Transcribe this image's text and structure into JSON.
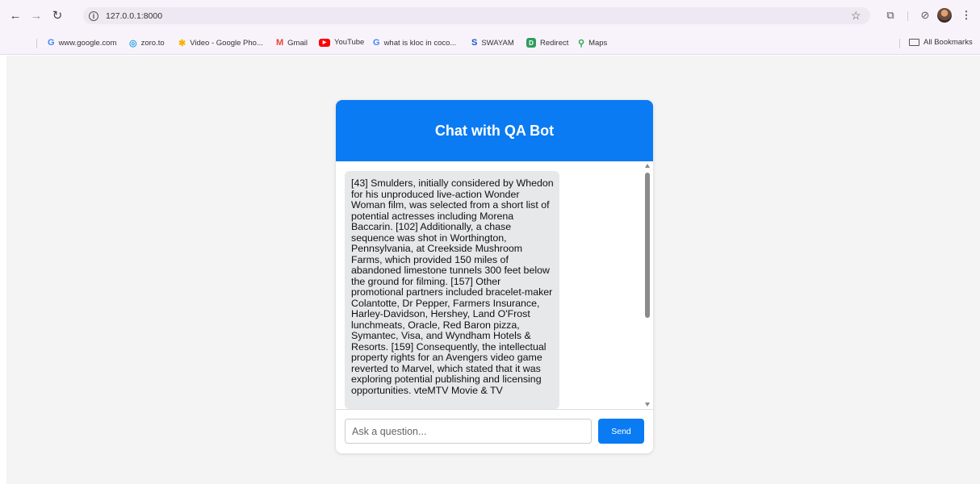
{
  "browser": {
    "url": "127.0.0.1:8000",
    "bookmarks": [
      {
        "label": "www.google.com",
        "icon": "google-icon",
        "color": "#4285f4",
        "glyph": "G"
      },
      {
        "label": "zoro.to",
        "icon": "zoro-icon",
        "color": "#29a3e0",
        "glyph": "◎"
      },
      {
        "label": "Video - Google Pho...",
        "icon": "google-photos-icon",
        "color": "#f4b400",
        "glyph": "✱"
      },
      {
        "label": "Gmail",
        "icon": "gmail-icon",
        "color": "#ea4335",
        "glyph": "M"
      },
      {
        "label": "YouTube",
        "icon": "youtube-icon",
        "color": "#ff0000",
        "glyph": "▶"
      },
      {
        "label": "what is kloc in coco...",
        "icon": "google-icon",
        "color": "#4285f4",
        "glyph": "G"
      },
      {
        "label": "SWAYAM",
        "icon": "swayam-icon",
        "color": "#1a56c6",
        "glyph": "S"
      },
      {
        "label": "Redirect",
        "icon": "redirect-icon",
        "color": "#2e9d5c",
        "glyph": "D"
      },
      {
        "label": "Maps",
        "icon": "maps-pin-icon",
        "color": "#34a853",
        "glyph": "⚲"
      }
    ],
    "all_bookmarks_label": "All Bookmarks"
  },
  "chat": {
    "title": "Chat with QA Bot",
    "messages": [
      {
        "sender": "bot",
        "text": "[43] Smulders, initially considered by Whedon for his unproduced live-action Wonder Woman film, was selected from a short list of potential actresses including Morena Baccarin. [102] Additionally, a chase sequence was shot in Worthington, Pennsylvania, at Creekside Mushroom Farms, which provided 150 miles of abandoned limestone tunnels 300 feet below the ground for filming. [157] Other promotional partners included bracelet-maker Colantotte, Dr Pepper, Farmers Insurance, Harley-Davidson, Hershey, Land O'Frost lunchmeats, Oracle, Red Baron pizza, Symantec, Visa, and Wyndham Hotels & Resorts. [159] Consequently, the intellectual property rights for an Avengers video game reverted to Marvel, which stated that it was exploring potential publishing and licensing opportunities. vteMTV Movie & TV"
      }
    ],
    "input_placeholder": "Ask a question...",
    "input_value": "",
    "send_label": "Send"
  },
  "colors": {
    "accent": "#0a7bf3",
    "bot_bubble": "#e7e8ea",
    "page_background": "#f4f4f4"
  }
}
